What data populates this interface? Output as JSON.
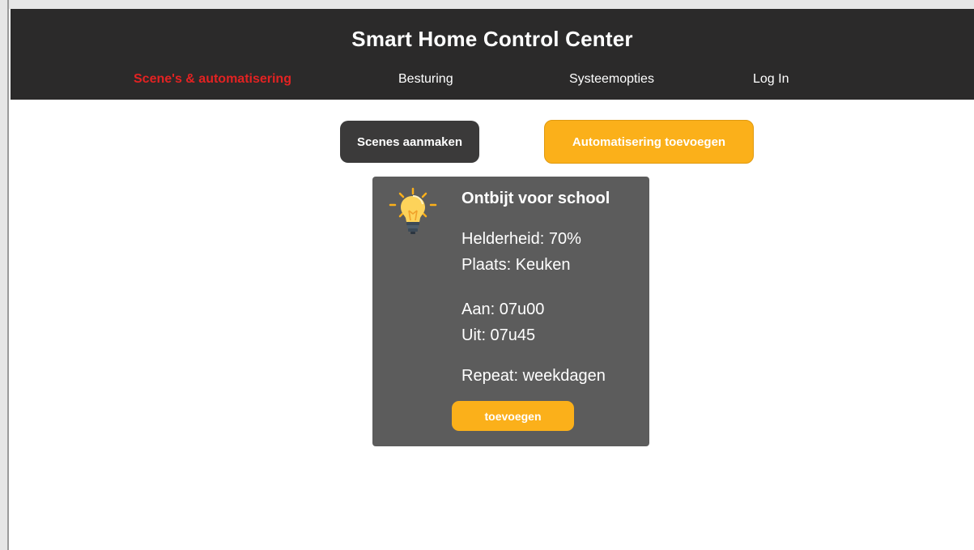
{
  "header": {
    "title": "Smart Home Control Center",
    "nav": [
      {
        "label": "Scene's & automatisering",
        "active": true
      },
      {
        "label": "Besturing",
        "active": false
      },
      {
        "label": "Systeemopties",
        "active": false
      },
      {
        "label": "Log In",
        "active": false
      }
    ]
  },
  "actions": {
    "create_scenes": "Scenes aanmaken",
    "add_automation": "Automatisering toevoegen"
  },
  "scene_card": {
    "icon": "lightbulb-icon",
    "title": "Ontbijt voor school",
    "brightness": "Helderheid: 70%",
    "location": "Plaats: Keuken",
    "on_time": "Aan: 07u00",
    "off_time": "Uit: 07u45",
    "repeat": "Repeat: weekdagen",
    "add_button": "toevoegen"
  },
  "colors": {
    "header_bg": "#2b2a2a",
    "active_nav": "#e32222",
    "accent_orange": "#fbb01a",
    "dark_button": "#3b3a3a",
    "card_bg": "#5c5c5c"
  }
}
